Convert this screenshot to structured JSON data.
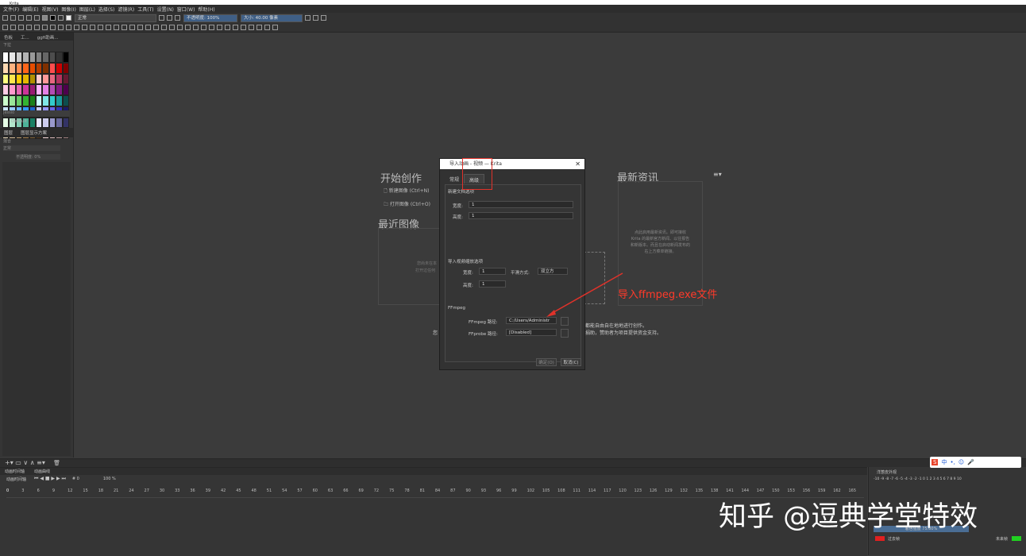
{
  "window": {
    "title": "Krita"
  },
  "menu": [
    "文件(F)",
    "编辑(E)",
    "视图(V)",
    "图像(I)",
    "图层(L)",
    "选择(S)",
    "滤镜(R)",
    "工具(T)",
    "设置(N)",
    "窗口(W)",
    "帮助(H)"
  ],
  "toolbar": {
    "blend_mode": "正常",
    "opacity_label": "不透明度:",
    "opacity_value": "100%",
    "size_label": "大小:",
    "size_value": "40.00 像素"
  },
  "left_dock": {
    "tabs": [
      "色板",
      "工...",
      "ggfi助画..."
    ],
    "palette_header": "下拉",
    "palette_name": "Default",
    "palette_field": "Jessio",
    "layers_tabs": [
      "图层",
      "图层显示方案"
    ],
    "layer_label": "混合",
    "blend": "正常",
    "opacity": "不透明度: 0%"
  },
  "welcome": {
    "start_title": "开始创作",
    "new_image": "新建图像 (Ctrl+N)",
    "open_image": "打开图像 (Ctrl+O)",
    "recent_title": "最近图像",
    "recent_hint_1": "您尚未在本",
    "recent_hint_2": "打开过任何",
    "news_title": "最新资讯",
    "news_text": [
      "点此启用最新资讯。即可接收",
      "Krita 的最新官方新闻、以往报告",
      "和新版本。而且在启动新闻发布的",
      "右上方菜单链接。"
    ],
    "bottom_text_1": "都能自由自在地地进行创作。",
    "bottom_text_2": "捐助，赞助者为项目提供资金支持。",
    "bottom_left": "您"
  },
  "dialog": {
    "title": "导入动画 - 视频 — Krita",
    "tabs": [
      "常规",
      "高级"
    ],
    "section_new": "新建文档选项",
    "width_label": "宽度:",
    "width_value": "1",
    "height_label": "高度:",
    "height_value": "1",
    "section_scale": "导入视频缩放选项",
    "scale_width_label": "宽度:",
    "scale_width_value": "1",
    "filter_label": "平滑方式:",
    "filter_value": "双立方",
    "scale_height_label": "高度:",
    "scale_height_value": "1",
    "section_ffmpeg": "FFmpeg",
    "ffmpeg_label": "FFmpeg 路径:",
    "ffmpeg_value": "C:/Users/Administr",
    "ffprobe_label": "FFprobe 路径:",
    "ffprobe_value": "[Disabled]",
    "ok": "确定(O)",
    "cancel": "取消(C)"
  },
  "annotation": "导入ffmpeg.exe文件",
  "timeline": {
    "tabs": [
      "动画时间轴",
      "动画曲线"
    ],
    "mode": "动画时间轴",
    "frame": "# 0",
    "speed": "100 %",
    "ruler": [
      "0",
      "3",
      "6",
      "9",
      "12",
      "15",
      "18",
      "21",
      "24",
      "27",
      "30",
      "33",
      "36",
      "39",
      "42",
      "45",
      "48",
      "51",
      "54",
      "57",
      "60",
      "63",
      "66",
      "69",
      "72",
      "75",
      "78",
      "81",
      "84",
      "87",
      "90",
      "93",
      "96",
      "99",
      "102",
      "105",
      "108",
      "111",
      "114",
      "117",
      "120",
      "123",
      "126",
      "129",
      "132",
      "135",
      "138",
      "141",
      "144",
      "147",
      "150",
      "153",
      "156",
      "159",
      "162",
      "165"
    ]
  },
  "onion": {
    "title": "洋葱皮外观",
    "scale": "-10 -9 -8 -7 -6 -5 -4 -3 -2 -1 0 1 2 3 4 5 6 7 8 9 10",
    "tint_label": "着色强度",
    "tint_value": "75.00%",
    "prev_label": "过去帧",
    "next_label": "未来帧"
  },
  "watermark": "知乎 @逗典学堂特效",
  "ime": [
    "中",
    "•,",
    "☺",
    "🎤"
  ]
}
